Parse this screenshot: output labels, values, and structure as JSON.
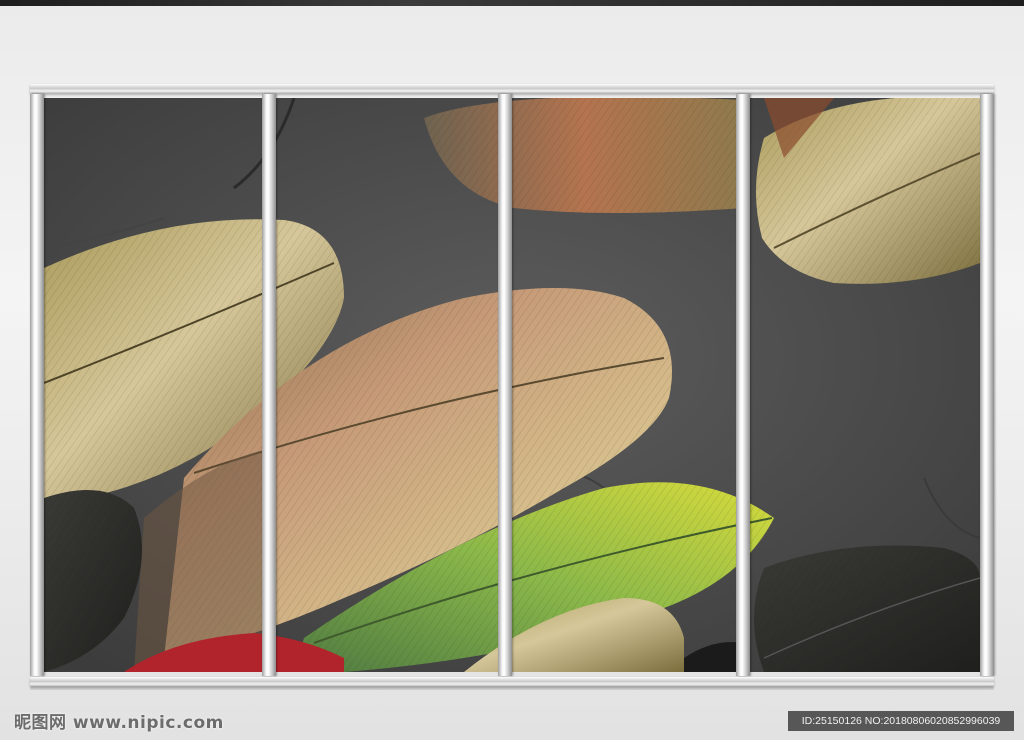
{
  "watermark": {
    "site_text": "昵图网 www.nipic.com"
  },
  "image_id": {
    "text": "ID:25150126 NO:20180806020852996039"
  },
  "scene": {
    "panel_count": 4,
    "frame_color": "#e6e6e6",
    "background_stone_color": "#4d4d4d",
    "feather_colors": [
      "#c9b87a",
      "#b89a6d",
      "#a7bf3c",
      "#2f2f2f",
      "#b2242b"
    ]
  }
}
